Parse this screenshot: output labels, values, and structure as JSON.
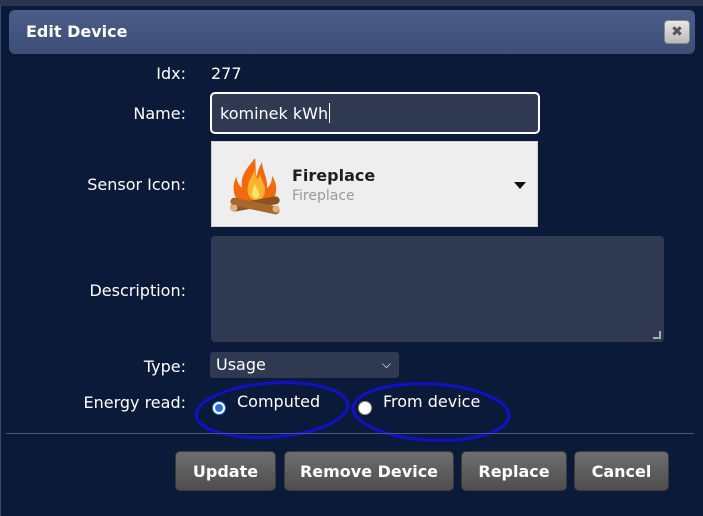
{
  "dialog": {
    "title": "Edit Device",
    "close_glyph": "✖"
  },
  "form": {
    "idx_label": "Idx:",
    "idx_value": "277",
    "name_label": "Name:",
    "name_value": "kominek kWh",
    "sensor_icon_label": "Sensor Icon:",
    "sensor_icon": {
      "title": "Fireplace",
      "subtitle": "Fireplace",
      "icon": "fireplace-icon"
    },
    "description_label": "Description:",
    "description_value": "",
    "type_label": "Type:",
    "type_value": "Usage",
    "energy_read_label": "Energy read:",
    "energy_options": [
      {
        "label": "Computed",
        "checked": true
      },
      {
        "label": "From device",
        "checked": false
      }
    ]
  },
  "buttons": {
    "update": "Update",
    "remove": "Remove Device",
    "replace": "Replace",
    "cancel": "Cancel"
  },
  "colors": {
    "background": "#0c1a3a",
    "titlebar": "#3d4f78",
    "input_bg": "#2f3a52",
    "button": "#5c5c5c",
    "annotation": "#1010c8"
  }
}
